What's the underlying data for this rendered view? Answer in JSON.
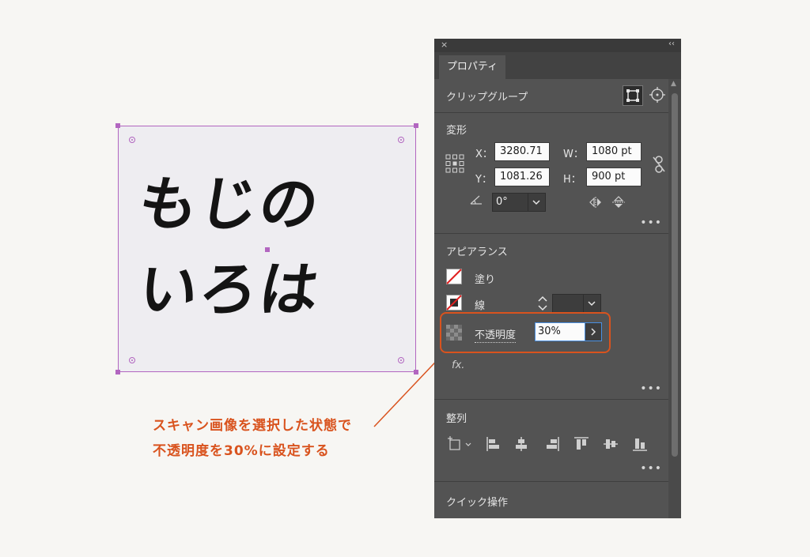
{
  "artwork": {
    "line1": "もじの",
    "line2": "いろは"
  },
  "callout": {
    "line1": "スキャン画像を選択した状態で",
    "line2": "不透明度を30%に設定する",
    "color": "#d9531e"
  },
  "panel": {
    "close_icon": "×",
    "collapse_icon": "‹‹",
    "tab_label": "プロパティ",
    "object_type": "クリップグループ",
    "transform": {
      "title": "変形",
      "x_label": "X：",
      "x_value": "3280.71",
      "y_label": "Y：",
      "y_value": "1081.26",
      "w_label": "W：",
      "w_value": "1080 pt",
      "h_label": "H：",
      "h_value": "900 pt",
      "angle_value": "0°"
    },
    "appearance": {
      "title": "アピアランス",
      "fill_label": "塗り",
      "stroke_label": "線",
      "opacity_label": "不透明度",
      "opacity_value": "30%",
      "fx_label": "fx."
    },
    "align": {
      "title": "整列"
    },
    "quick_actions": {
      "title": "クイック操作"
    },
    "more_label": "•••"
  }
}
